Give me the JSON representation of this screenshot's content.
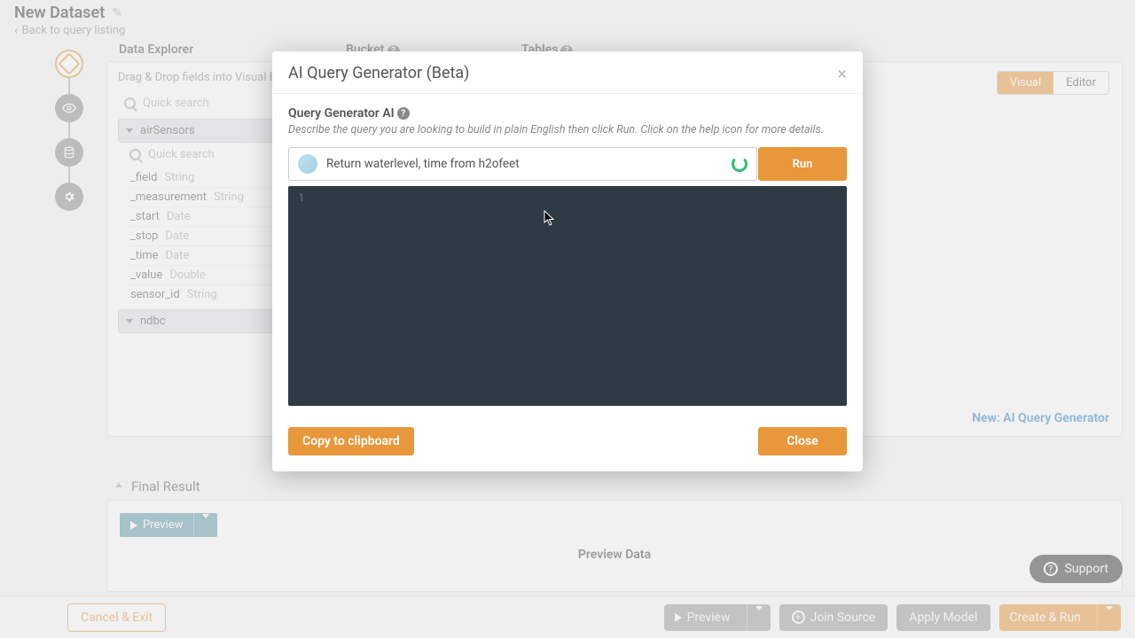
{
  "header": {
    "title": "New Dataset",
    "back": "Back to query listing"
  },
  "panel": {
    "headers": {
      "explorer": "Data Explorer",
      "bucket": "Bucket",
      "tables": "Tables"
    },
    "drag_hint": "Drag & Drop fields into Visual Build",
    "visual": "Visual",
    "editor": "Editor",
    "search": "Quick search",
    "tree": {
      "node1": "airSensors",
      "node2": "ndbc",
      "fields": [
        {
          "name": "_field",
          "type": "String"
        },
        {
          "name": "_measurement",
          "type": "String"
        },
        {
          "name": "_start",
          "type": "Date"
        },
        {
          "name": "_stop",
          "type": "Date"
        },
        {
          "name": "_time",
          "type": "Date"
        },
        {
          "name": "_value",
          "type": "Double"
        },
        {
          "name": "sensor_id",
          "type": "String"
        }
      ]
    },
    "ai_link": "New: AI Query Generator"
  },
  "final": {
    "title": "Final Result",
    "preview": "Preview",
    "preview_data": "Preview Data"
  },
  "footer": {
    "cancel": "Cancel & Exit",
    "preview": "Preview",
    "join": "Join Source",
    "apply": "Apply Model",
    "create": "Create & Run"
  },
  "support": "Support",
  "modal": {
    "title": "AI Query Generator (Beta)",
    "section_label": "Query Generator AI",
    "section_desc": "Describe the query you are looking to build in plain English then click Run. Click on the help icon for more details.",
    "input_value": "Return waterlevel, time from h2ofeet",
    "run": "Run",
    "gutter1": "1",
    "copy": "Copy to clipboard",
    "close": "Close"
  }
}
